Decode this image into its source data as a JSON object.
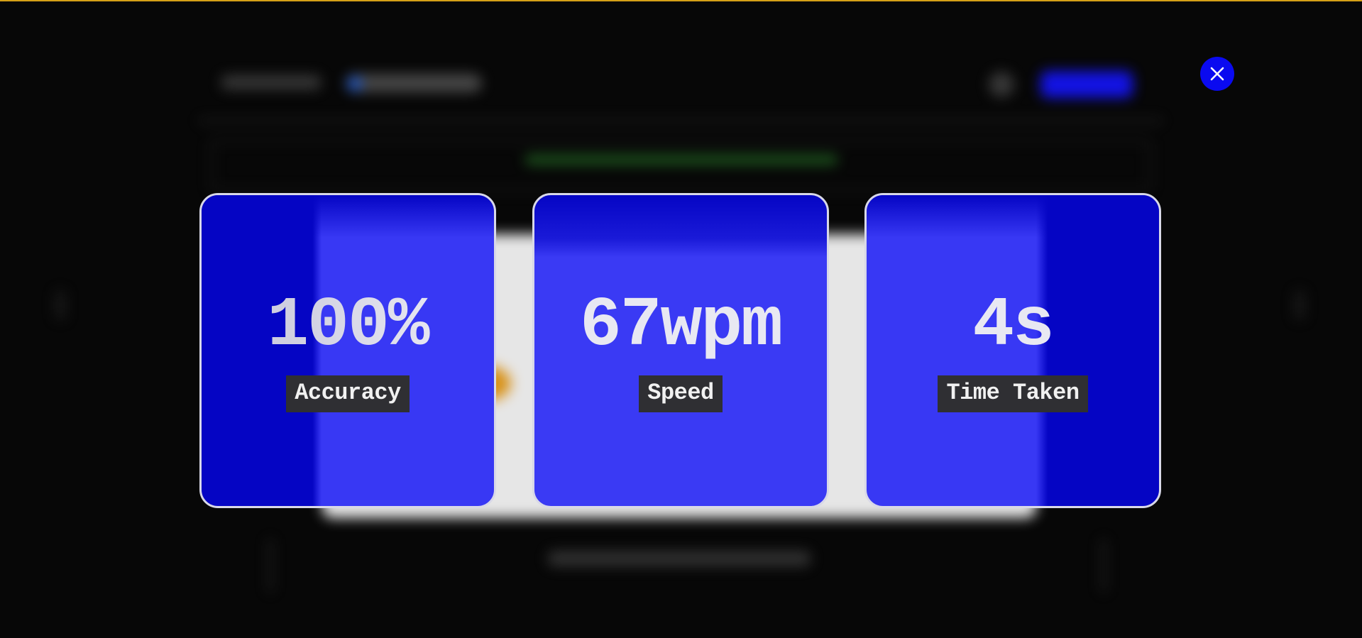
{
  "results": {
    "stats": [
      {
        "value": "100%",
        "label": "Accuracy"
      },
      {
        "value": "67wpm",
        "label": "Speed"
      },
      {
        "value": "4s",
        "label": "Time Taken"
      }
    ]
  },
  "icons": {
    "close": "close-icon"
  },
  "colors": {
    "accent_top": "#d4a017",
    "card_blue_dark": "#0505c4",
    "card_blue_light": "#3838f4",
    "close_button": "#0a0af0",
    "label_bg": "#2f2f33",
    "background": "#070707"
  }
}
